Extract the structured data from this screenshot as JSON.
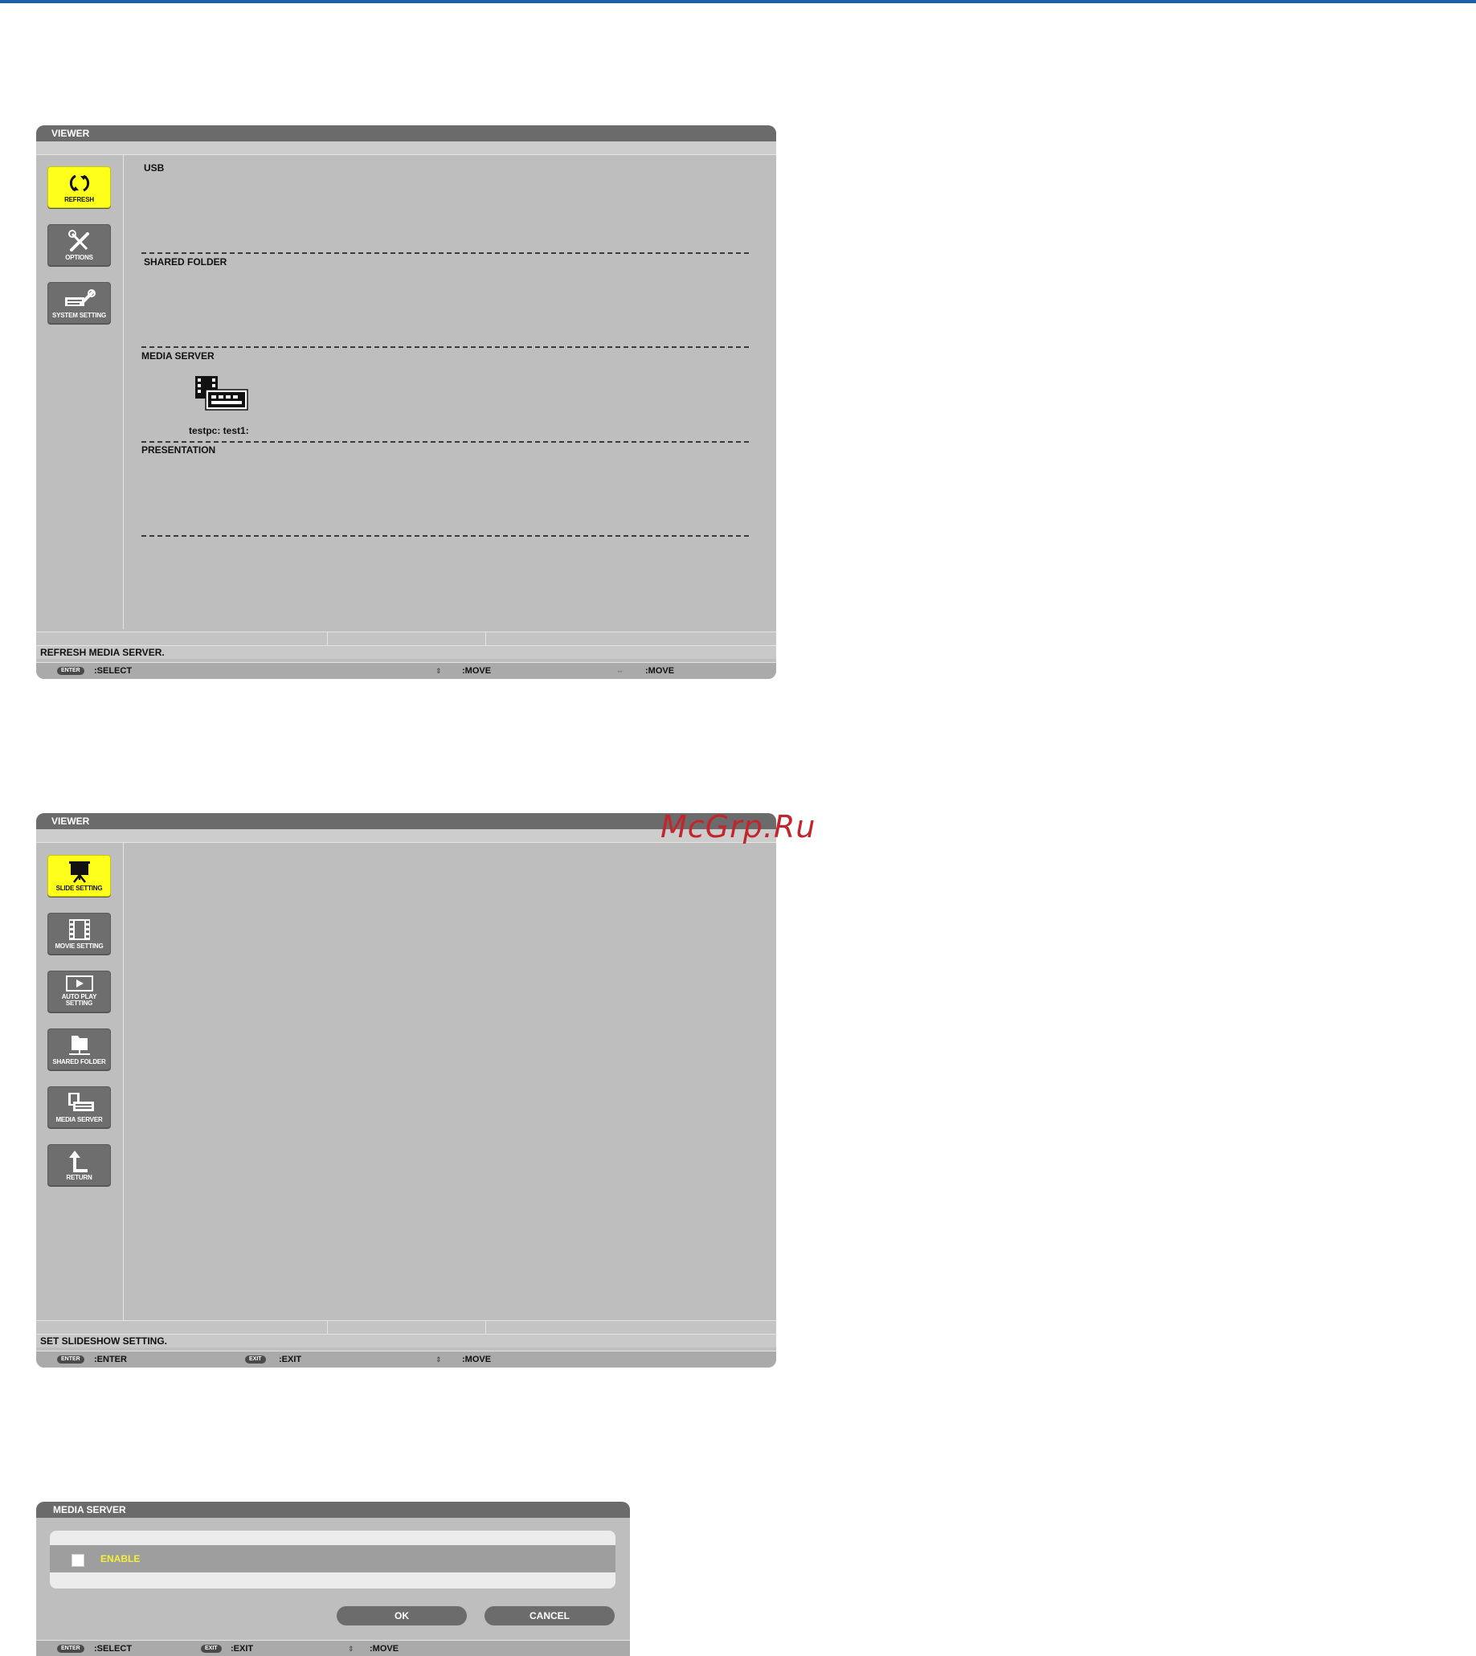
{
  "viewer1": {
    "title": "VIEWER",
    "tiles": [
      {
        "label": "REFRESH",
        "icon": "refresh-icon"
      },
      {
        "label": "OPTIONS",
        "icon": "options-icon"
      },
      {
        "label": "SYSTEM SETTING",
        "icon": "system-setting-icon"
      }
    ],
    "sections": {
      "usb": "USB",
      "shared_folder": "SHARED FOLDER",
      "media_server": "MEDIA SERVER",
      "presentation": "PRESENTATION"
    },
    "media_item_label": "testpc: test1:",
    "message": "REFRESH MEDIA SERVER.",
    "keys": {
      "enter_key": "ENTER",
      "enter_action": ":SELECT",
      "updown_action": ":MOVE",
      "leftright_action": ":MOVE"
    }
  },
  "viewer2": {
    "title": "VIEWER",
    "tiles": [
      {
        "label": "SLIDE SETTING",
        "icon": "slide-setting-icon"
      },
      {
        "label": "MOVIE SETTING",
        "icon": "movie-setting-icon"
      },
      {
        "label_line1": "AUTO PLAY",
        "label_line2": "SETTING",
        "icon": "auto-play-icon"
      },
      {
        "label": "SHARED FOLDER",
        "icon": "shared-folder-icon"
      },
      {
        "label": "MEDIA SERVER",
        "icon": "media-server-icon"
      },
      {
        "label": "RETURN",
        "icon": "return-icon"
      }
    ],
    "message": "SET SLIDESHOW SETTING.",
    "keys": {
      "enter_key": "ENTER",
      "enter_action": ":ENTER",
      "exit_key": "EXIT",
      "exit_action": ":EXIT",
      "updown_action": ":MOVE"
    }
  },
  "watermark": "McGrp.Ru",
  "dialog": {
    "title": "MEDIA SERVER",
    "checkbox_label": "ENABLE",
    "checkbox_checked": false,
    "ok_label": "OK",
    "cancel_label": "CANCEL",
    "keys": {
      "enter_key": "ENTER",
      "enter_action": ":SELECT",
      "exit_key": "EXIT",
      "exit_action": ":EXIT",
      "updown_action": ":MOVE"
    }
  },
  "colors": {
    "accent_line": "#1f5fa8",
    "selected_tile": "#ffff1c",
    "titlebar": "#6b6b6b",
    "panel": "#bebebe",
    "enable_text": "#f6ee3a",
    "watermark": "#c0262c"
  }
}
